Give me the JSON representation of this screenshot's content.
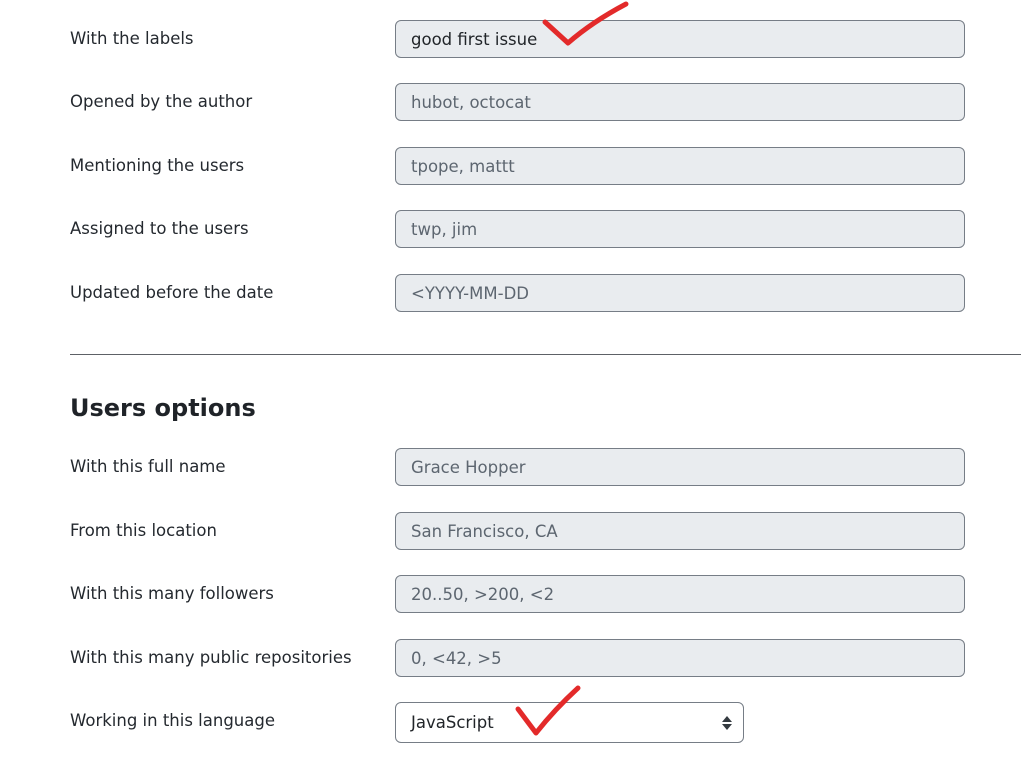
{
  "issues_options": {
    "fields": [
      {
        "label": "With the labels",
        "value": "good first issue",
        "placeholder": ""
      },
      {
        "label": "Opened by the author",
        "value": "",
        "placeholder": "hubot, octocat"
      },
      {
        "label": "Mentioning the users",
        "value": "",
        "placeholder": "tpope, mattt"
      },
      {
        "label": "Assigned to the users",
        "value": "",
        "placeholder": "twp, jim"
      },
      {
        "label": "Updated before the date",
        "value": "",
        "placeholder": "<YYYY-MM-DD"
      }
    ]
  },
  "users_options": {
    "heading": "Users options",
    "fields": [
      {
        "label": "With this full name",
        "value": "",
        "placeholder": "Grace Hopper"
      },
      {
        "label": "From this location",
        "value": "",
        "placeholder": "San Francisco, CA"
      },
      {
        "label": "With this many followers",
        "value": "",
        "placeholder": "20..50, >200, <2"
      },
      {
        "label": "With this many public repositories",
        "value": "",
        "placeholder": "0, <42, >5"
      }
    ],
    "language": {
      "label": "Working in this language",
      "selected": "JavaScript"
    }
  },
  "annotations": {
    "check_color": "#e32a2a"
  }
}
